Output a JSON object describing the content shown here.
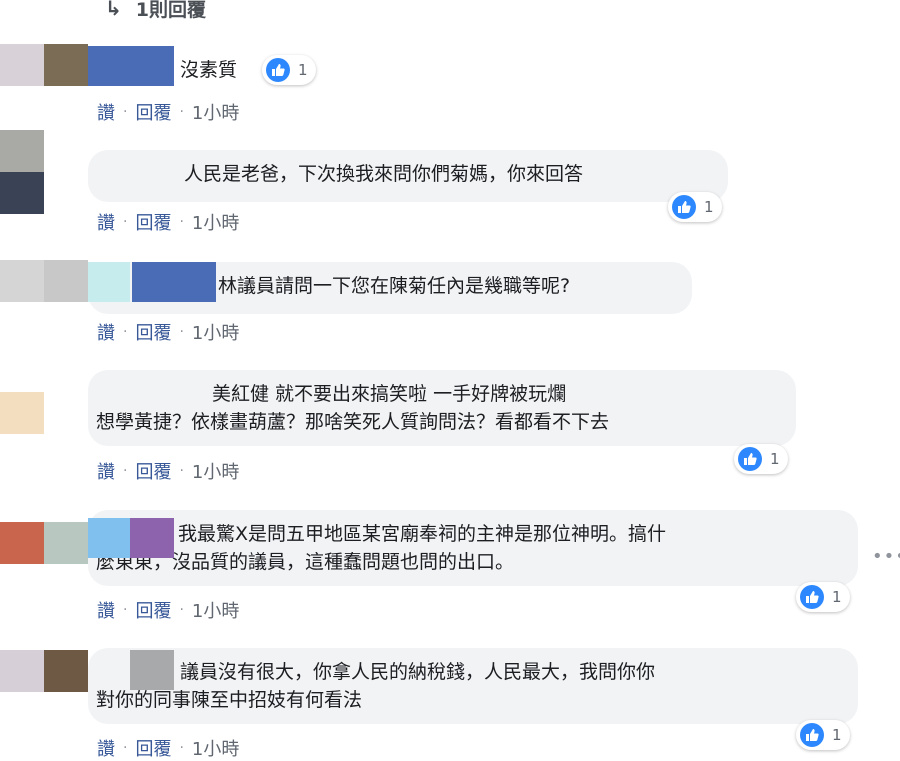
{
  "thread": {
    "reply_icon": "reply-arrow-icon",
    "reply_count_label": "1則回覆"
  },
  "actions": {
    "like_label": "讚",
    "reply_label": "回覆",
    "separator": "·",
    "time": "1小時"
  },
  "comments": [
    {
      "lines": [
        "沒素質"
      ],
      "reaction": {
        "icon": "like-icon",
        "count": "1"
      }
    },
    {
      "lines": [
        "人民是老爸，下次換我來問你們菊媽，你來回答"
      ],
      "reaction": {
        "icon": "like-icon",
        "count": "1"
      }
    },
    {
      "lines": [
        "林議員請問一下您在陳菊任內是幾職等呢?"
      ]
    },
    {
      "lines": [
        "美紅健 就不要出來搞笑啦 一手好牌被玩爛",
        "想學黃捷？依樣畫葫蘆？那啥笑死人質詢問法？看都看不下去"
      ],
      "reaction": {
        "icon": "like-icon",
        "count": "1"
      }
    },
    {
      "lines": [
        "我最驚X是問五甲地區某宮廟奉祠的主神是那位神明。搞什",
        "麼東東，沒品質的議員，這種蠢問題也問的出口。"
      ],
      "reaction": {
        "icon": "like-icon",
        "count": "1"
      }
    },
    {
      "lines": [
        "議員沒有很大，你拿人民的納稅錢，人民最大，我問你你",
        "對你的同事陳至中招妓有何看法"
      ],
      "reaction": {
        "icon": "like-icon",
        "count": "1"
      }
    }
  ],
  "more_icon": "more-options-icon",
  "more_glyph": "•••",
  "colors": {
    "link": "#385898",
    "bubble": "#f2f3f5",
    "like": "#2d88ff"
  }
}
